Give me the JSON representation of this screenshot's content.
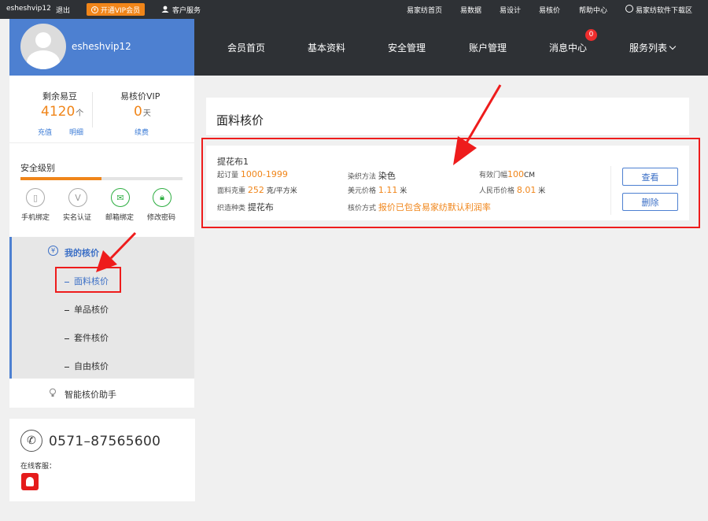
{
  "topbar": {
    "username": "esheshvip12",
    "logout": "退出",
    "vip_button": "开通VIP会员",
    "customer_service": "客户服务",
    "links": [
      "易家纺首页",
      "易数据",
      "易设计",
      "易核价",
      "帮助中心"
    ],
    "download": "易家纺软件下载区"
  },
  "profile": {
    "username": "esheshvip12"
  },
  "nav": {
    "items": [
      "会员首页",
      "基本资料",
      "安全管理",
      "账户管理",
      "消息中心"
    ],
    "service_list": "服务列表",
    "message_badge": "0"
  },
  "stats": {
    "beans_label": "剩余易豆",
    "beans_value": "4120",
    "beans_unit": "个",
    "recharge": "充值",
    "detail": "明细",
    "vip_label": "易核价VIP",
    "vip_value": "0",
    "vip_unit": "天",
    "renew": "续费"
  },
  "security": {
    "title": "安全级别",
    "level": 0.5,
    "items": [
      "手机绑定",
      "实名认证",
      "邮箱绑定",
      "修改密码"
    ]
  },
  "menu": {
    "title": "我的核价",
    "items": [
      "面料核价",
      "单品核价",
      "套件核价",
      "自由核价"
    ],
    "assistant": "智能核价助手"
  },
  "contact": {
    "phone": "0571–87565600",
    "online_label": "在线客服："
  },
  "panel": {
    "title": "面料核价"
  },
  "record": {
    "name": "提花布1",
    "moq_label": "起订量",
    "moq_value": "1000-1999",
    "dye_label": "染织方法",
    "dye_value": "染色",
    "width_label": "有效门幅",
    "width_value": "100",
    "width_unit": "CM",
    "weight_label": "面料克重",
    "weight_value": "252",
    "weight_unit": "克/平方米",
    "usd_label": "美元价格",
    "usd_value": "1.11",
    "usd_unit": "米",
    "rmb_label": "人民币价格",
    "rmb_value": "8.01",
    "rmb_unit": "米",
    "weave_label": "织造种类",
    "weave_value": "提花布",
    "pricing_label": "核价方式",
    "pricing_value": "报价已包含易家纺默认利润率",
    "view_button": "查看",
    "delete_button": "删除"
  },
  "colors": {
    "topbar": "#2e3135",
    "brand_blue": "#4d80d1",
    "orange": "#f08519",
    "highlight_red": "#ee1c1c"
  }
}
